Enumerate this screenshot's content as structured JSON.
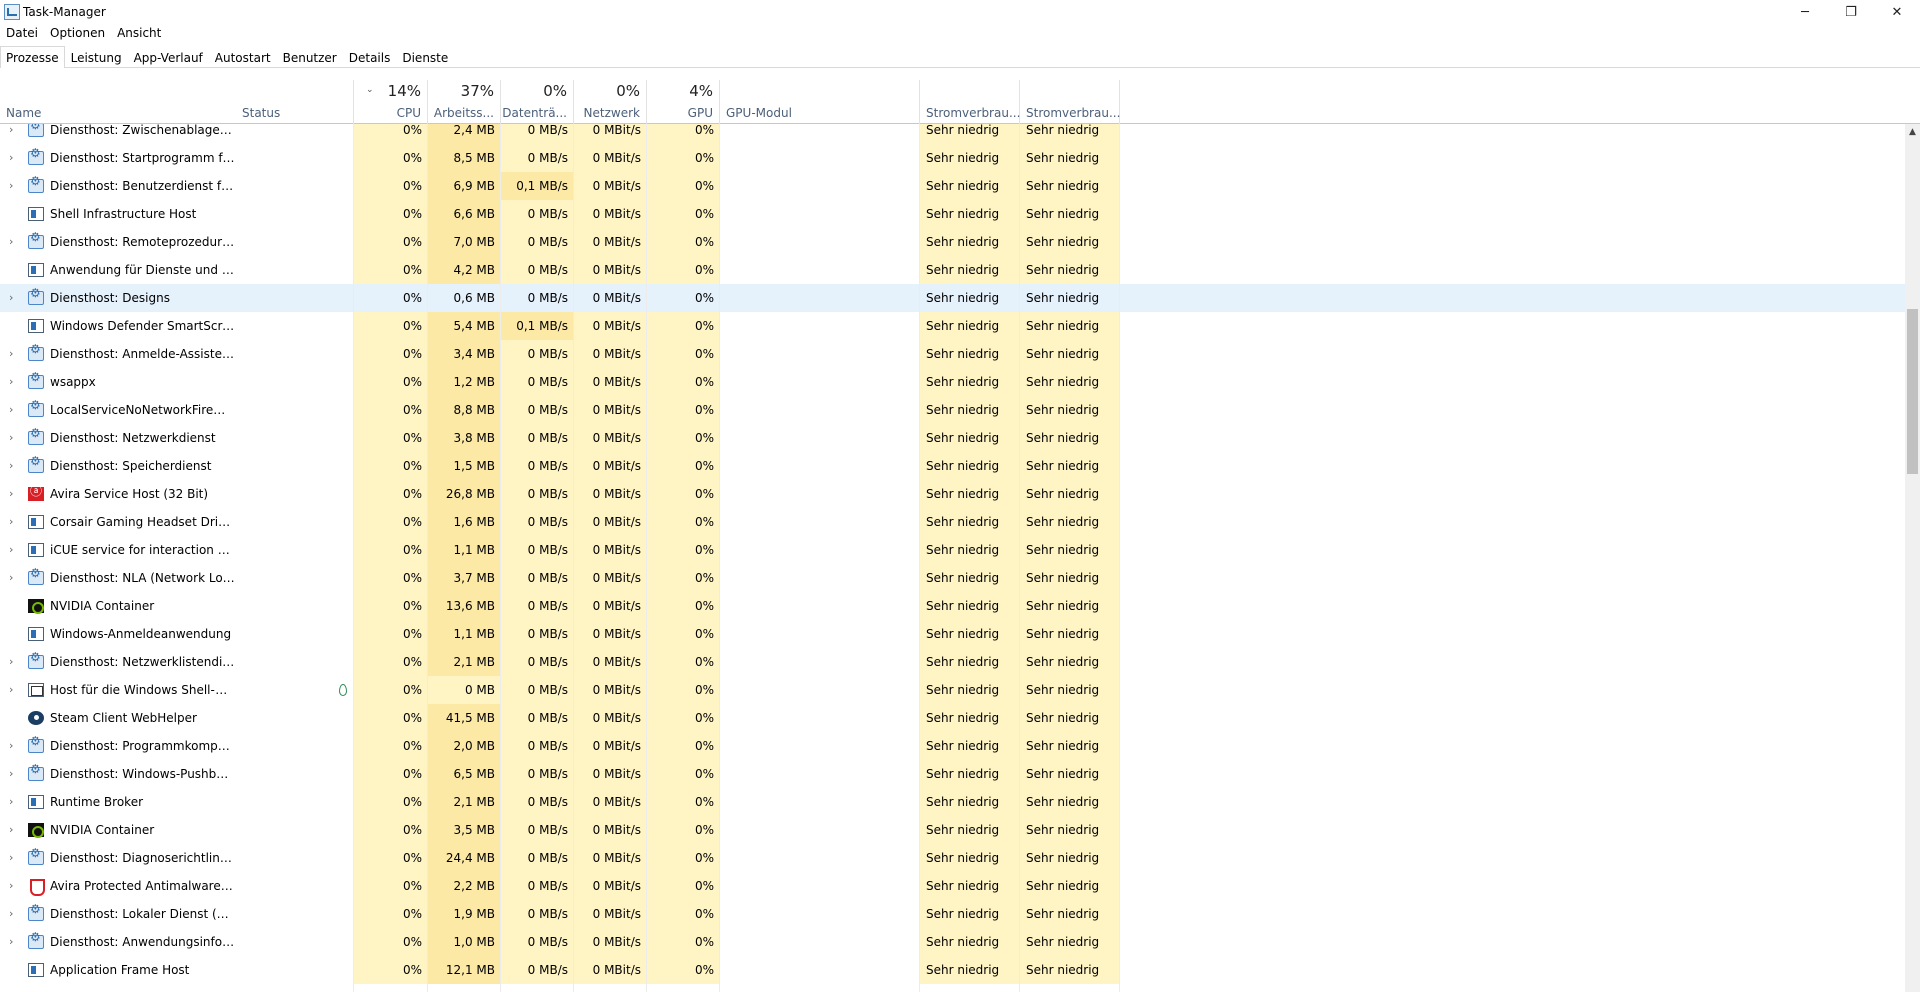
{
  "window": {
    "title": "Task-Manager",
    "minimize": "─",
    "restore": "❐",
    "close": "✕"
  },
  "menu": [
    "Datei",
    "Optionen",
    "Ansicht"
  ],
  "tabs": [
    "Prozesse",
    "Leistung",
    "App-Verlauf",
    "Autostart",
    "Benutzer",
    "Details",
    "Dienste"
  ],
  "active_tab": "Prozesse",
  "columns": {
    "name": "Name",
    "status": "Status",
    "cpu": {
      "pct": "14%",
      "label": "CPU"
    },
    "memory": {
      "pct": "37%",
      "label": "Arbeitss..."
    },
    "disk": {
      "pct": "0%",
      "label": "Datenträ..."
    },
    "network": {
      "pct": "0%",
      "label": "Netzwerk"
    },
    "gpu": {
      "pct": "4%",
      "label": "GPU"
    },
    "gpu_engine": "GPU-Modul",
    "power": "Stromverbrau...",
    "power_trend": "Stromverbrau..."
  },
  "rows": [
    {
      "name": "Diensthost: Zwischenablage-Be...",
      "icon": "gear-icon",
      "expand": true,
      "cpu": "0%",
      "mem": "2,4 MB",
      "disk": "0 MB/s",
      "net": "0 MBit/s",
      "gpu": "0%",
      "power": "Sehr niedrig",
      "trend": "Sehr niedrig"
    },
    {
      "name": "Diensthost: Startprogramm für ...",
      "icon": "gear-icon",
      "expand": true,
      "cpu": "0%",
      "mem": "8,5 MB",
      "disk": "0 MB/s",
      "net": "0 MBit/s",
      "gpu": "0%",
      "power": "Sehr niedrig",
      "trend": "Sehr niedrig"
    },
    {
      "name": "Diensthost: Benutzerdienst für d...",
      "icon": "gear-icon",
      "expand": true,
      "cpu": "0%",
      "mem": "6,9 MB",
      "disk": "0,1 MB/s",
      "net": "0 MBit/s",
      "gpu": "0%",
      "power": "Sehr niedrig",
      "trend": "Sehr niedrig"
    },
    {
      "name": "Shell Infrastructure Host",
      "icon": "window-icon",
      "expand": false,
      "cpu": "0%",
      "mem": "6,6 MB",
      "disk": "0 MB/s",
      "net": "0 MBit/s",
      "gpu": "0%",
      "power": "Sehr niedrig",
      "trend": "Sehr niedrig"
    },
    {
      "name": "Diensthost: Remoteprozeduraufr...",
      "icon": "gear-icon",
      "expand": true,
      "cpu": "0%",
      "mem": "7,0 MB",
      "disk": "0 MB/s",
      "net": "0 MBit/s",
      "gpu": "0%",
      "power": "Sehr niedrig",
      "trend": "Sehr niedrig"
    },
    {
      "name": "Anwendung für Dienste und Co...",
      "icon": "window-icon",
      "expand": false,
      "cpu": "0%",
      "mem": "4,2 MB",
      "disk": "0 MB/s",
      "net": "0 MBit/s",
      "gpu": "0%",
      "power": "Sehr niedrig",
      "trend": "Sehr niedrig"
    },
    {
      "name": "Diensthost: Designs",
      "icon": "gear-icon",
      "expand": true,
      "cpu": "0%",
      "mem": "0,6 MB",
      "disk": "0 MB/s",
      "net": "0 MBit/s",
      "gpu": "0%",
      "power": "Sehr niedrig",
      "trend": "Sehr niedrig"
    },
    {
      "name": "Windows Defender SmartScreen",
      "icon": "window-icon",
      "expand": false,
      "cpu": "0%",
      "mem": "5,4 MB",
      "disk": "0,1 MB/s",
      "net": "0 MBit/s",
      "gpu": "0%",
      "power": "Sehr niedrig",
      "trend": "Sehr niedrig"
    },
    {
      "name": "Diensthost: Anmelde-Assistent f...",
      "icon": "gear-icon",
      "expand": true,
      "cpu": "0%",
      "mem": "3,4 MB",
      "disk": "0 MB/s",
      "net": "0 MBit/s",
      "gpu": "0%",
      "power": "Sehr niedrig",
      "trend": "Sehr niedrig"
    },
    {
      "name": "wsappx",
      "icon": "gear-icon",
      "expand": true,
      "cpu": "0%",
      "mem": "1,2 MB",
      "disk": "0 MB/s",
      "net": "0 MBit/s",
      "gpu": "0%",
      "power": "Sehr niedrig",
      "trend": "Sehr niedrig"
    },
    {
      "name": "LocalServiceNoNetworkFirewall ...",
      "icon": "gear-icon",
      "expand": true,
      "cpu": "0%",
      "mem": "8,8 MB",
      "disk": "0 MB/s",
      "net": "0 MBit/s",
      "gpu": "0%",
      "power": "Sehr niedrig",
      "trend": "Sehr niedrig"
    },
    {
      "name": "Diensthost: Netzwerkdienst",
      "icon": "gear-icon",
      "expand": true,
      "cpu": "0%",
      "mem": "3,8 MB",
      "disk": "0 MB/s",
      "net": "0 MBit/s",
      "gpu": "0%",
      "power": "Sehr niedrig",
      "trend": "Sehr niedrig"
    },
    {
      "name": "Diensthost: Speicherdienst",
      "icon": "gear-icon",
      "expand": true,
      "cpu": "0%",
      "mem": "1,5 MB",
      "disk": "0 MB/s",
      "net": "0 MBit/s",
      "gpu": "0%",
      "power": "Sehr niedrig",
      "trend": "Sehr niedrig"
    },
    {
      "name": "Avira Service Host (32 Bit)",
      "icon": "avira-icon",
      "expand": true,
      "cpu": "0%",
      "mem": "26,8 MB",
      "disk": "0 MB/s",
      "net": "0 MBit/s",
      "gpu": "0%",
      "power": "Sehr niedrig",
      "trend": "Sehr niedrig"
    },
    {
      "name": "Corsair Gaming Headset Drivers",
      "icon": "window-icon",
      "expand": true,
      "cpu": "0%",
      "mem": "1,6 MB",
      "disk": "0 MB/s",
      "net": "0 MBit/s",
      "gpu": "0%",
      "power": "Sehr niedrig",
      "trend": "Sehr niedrig"
    },
    {
      "name": "iCUE service for interaction with...",
      "icon": "window-icon",
      "expand": true,
      "cpu": "0%",
      "mem": "1,1 MB",
      "disk": "0 MB/s",
      "net": "0 MBit/s",
      "gpu": "0%",
      "power": "Sehr niedrig",
      "trend": "Sehr niedrig"
    },
    {
      "name": "Diensthost: NLA (Network Locat...",
      "icon": "gear-icon",
      "expand": true,
      "cpu": "0%",
      "mem": "3,7 MB",
      "disk": "0 MB/s",
      "net": "0 MBit/s",
      "gpu": "0%",
      "power": "Sehr niedrig",
      "trend": "Sehr niedrig"
    },
    {
      "name": "NVIDIA Container",
      "icon": "nvidia-icon",
      "expand": false,
      "cpu": "0%",
      "mem": "13,6 MB",
      "disk": "0 MB/s",
      "net": "0 MBit/s",
      "gpu": "0%",
      "power": "Sehr niedrig",
      "trend": "Sehr niedrig"
    },
    {
      "name": "Windows-Anmeldeanwendung",
      "icon": "window-icon",
      "expand": false,
      "cpu": "0%",
      "mem": "1,1 MB",
      "disk": "0 MB/s",
      "net": "0 MBit/s",
      "gpu": "0%",
      "power": "Sehr niedrig",
      "trend": "Sehr niedrig"
    },
    {
      "name": "Diensthost: Netzwerklistendienst",
      "icon": "gear-icon",
      "expand": true,
      "cpu": "0%",
      "mem": "2,1 MB",
      "disk": "0 MB/s",
      "net": "0 MBit/s",
      "gpu": "0%",
      "power": "Sehr niedrig",
      "trend": "Sehr niedrig"
    },
    {
      "name": "Host für die Windows Shell-Obe...",
      "icon": "host-icon",
      "expand": true,
      "suspended": true,
      "cpu": "0%",
      "mem": "0 MB",
      "disk": "0 MB/s",
      "net": "0 MBit/s",
      "gpu": "0%",
      "power": "Sehr niedrig",
      "trend": "Sehr niedrig"
    },
    {
      "name": "Steam Client WebHelper",
      "icon": "steam-icon",
      "expand": false,
      "cpu": "0%",
      "mem": "41,5 MB",
      "disk": "0 MB/s",
      "net": "0 MBit/s",
      "gpu": "0%",
      "power": "Sehr niedrig",
      "trend": "Sehr niedrig"
    },
    {
      "name": "Diensthost: Programmkompati...",
      "icon": "gear-icon",
      "expand": true,
      "cpu": "0%",
      "mem": "2,0 MB",
      "disk": "0 MB/s",
      "net": "0 MBit/s",
      "gpu": "0%",
      "power": "Sehr niedrig",
      "trend": "Sehr niedrig"
    },
    {
      "name": "Diensthost: Windows-Pushbena...",
      "icon": "gear-icon",
      "expand": true,
      "cpu": "0%",
      "mem": "6,5 MB",
      "disk": "0 MB/s",
      "net": "0 MBit/s",
      "gpu": "0%",
      "power": "Sehr niedrig",
      "trend": "Sehr niedrig"
    },
    {
      "name": "Runtime Broker",
      "icon": "window-icon",
      "expand": true,
      "cpu": "0%",
      "mem": "2,1 MB",
      "disk": "0 MB/s",
      "net": "0 MBit/s",
      "gpu": "0%",
      "power": "Sehr niedrig",
      "trend": "Sehr niedrig"
    },
    {
      "name": "NVIDIA Container",
      "icon": "nvidia-icon",
      "expand": true,
      "cpu": "0%",
      "mem": "3,5 MB",
      "disk": "0 MB/s",
      "net": "0 MBit/s",
      "gpu": "0%",
      "power": "Sehr niedrig",
      "trend": "Sehr niedrig"
    },
    {
      "name": "Diensthost: Diagnoserichtlinien...",
      "icon": "gear-icon",
      "expand": true,
      "cpu": "0%",
      "mem": "24,4 MB",
      "disk": "0 MB/s",
      "net": "0 MBit/s",
      "gpu": "0%",
      "power": "Sehr niedrig",
      "trend": "Sehr niedrig"
    },
    {
      "name": "Avira Protected Antimalware Se...",
      "icon": "shield-icon",
      "expand": true,
      "cpu": "0%",
      "mem": "2,2 MB",
      "disk": "0 MB/s",
      "net": "0 MBit/s",
      "gpu": "0%",
      "power": "Sehr niedrig",
      "trend": "Sehr niedrig"
    },
    {
      "name": "Diensthost: Lokaler Dienst (Netz...",
      "icon": "gear-icon",
      "expand": true,
      "cpu": "0%",
      "mem": "1,9 MB",
      "disk": "0 MB/s",
      "net": "0 MBit/s",
      "gpu": "0%",
      "power": "Sehr niedrig",
      "trend": "Sehr niedrig"
    },
    {
      "name": "Diensthost: Anwendungsinform...",
      "icon": "gear-icon",
      "expand": true,
      "cpu": "0%",
      "mem": "1,0 MB",
      "disk": "0 MB/s",
      "net": "0 MBit/s",
      "gpu": "0%",
      "power": "Sehr niedrig",
      "trend": "Sehr niedrig"
    },
    {
      "name": "Application Frame Host",
      "icon": "window-icon",
      "expand": false,
      "cpu": "0%",
      "mem": "12,1 MB",
      "disk": "0 MB/s",
      "net": "0 MBit/s",
      "gpu": "0%",
      "power": "Sehr niedrig",
      "trend": "Sehr niedrig"
    }
  ],
  "highlighted_row": "Diensthost: Designs",
  "colors": {
    "usage_light": "#fff4c4",
    "usage_strong": "#fde9a6",
    "selection": "#e5f1fb",
    "header_label": "#4c607a"
  }
}
